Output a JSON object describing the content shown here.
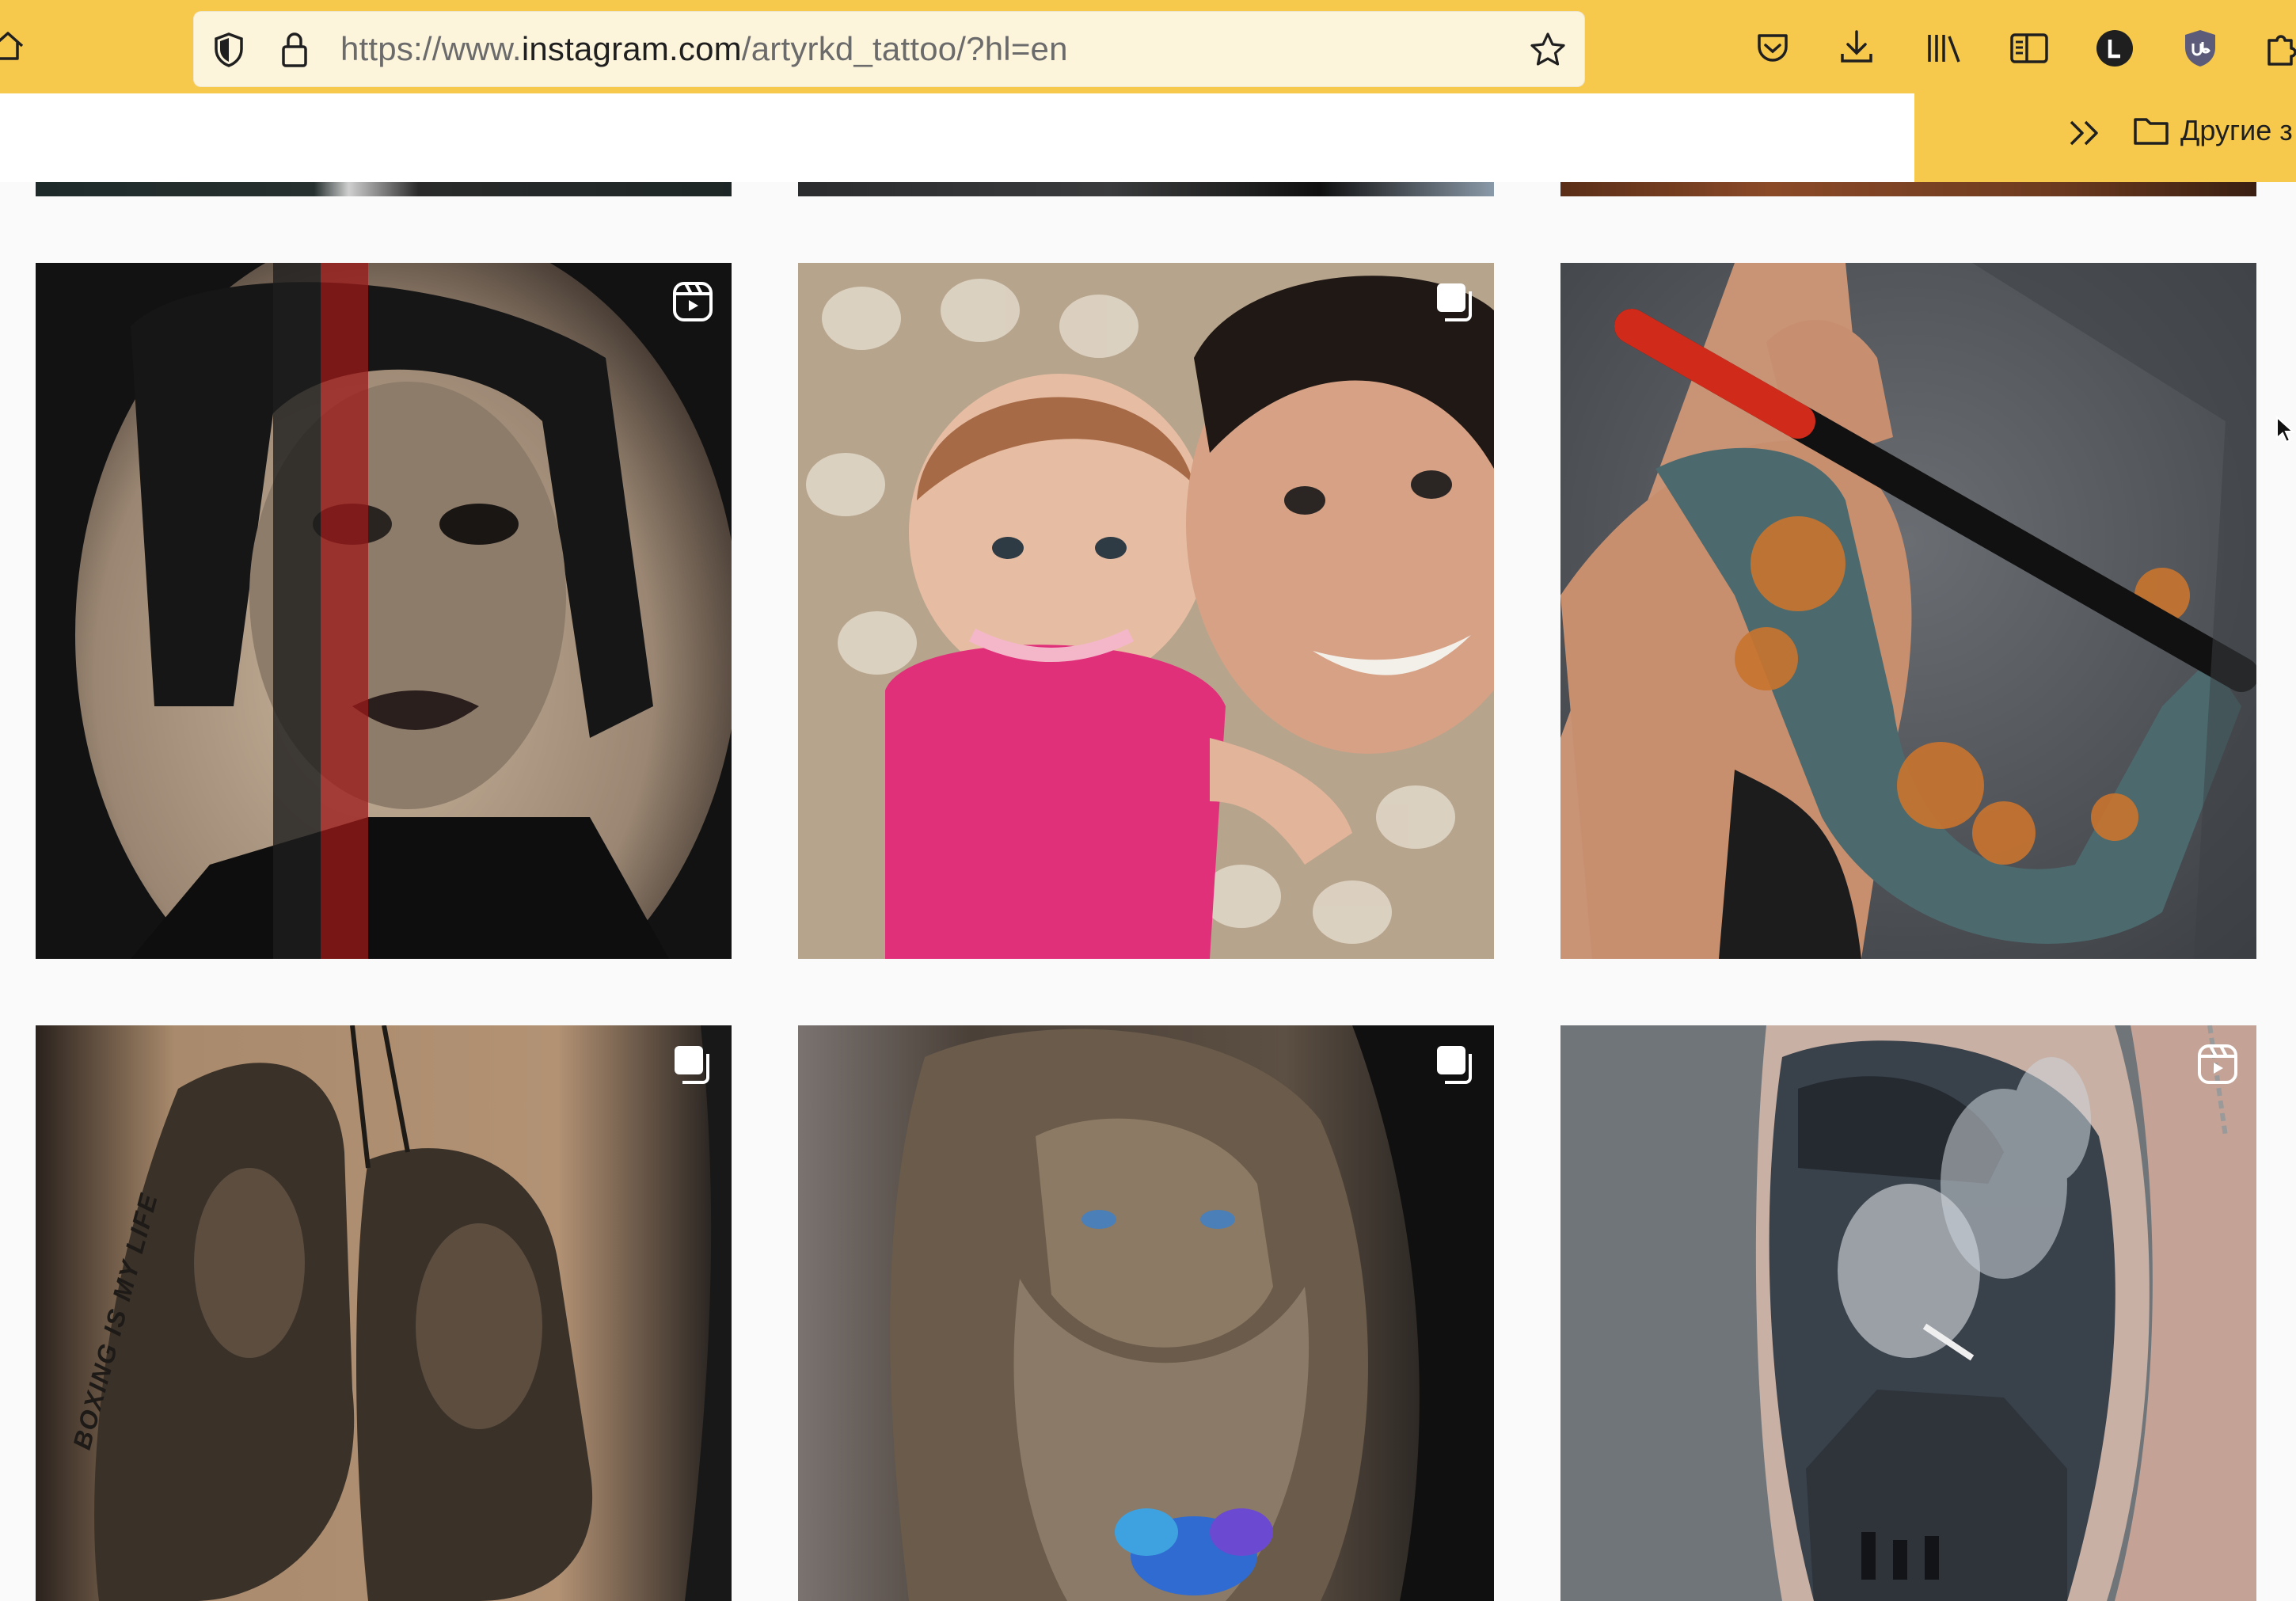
{
  "browser": {
    "url_prefix": "https://www.",
    "url_domain": "instagram.com",
    "url_suffix": "/artyrkd_tattoo/?hl=en",
    "bookmarks_folder_label": "Другие з",
    "toolbar_color": "#f6c94c",
    "icons": [
      "home-icon",
      "shield-icon",
      "lock-icon",
      "star-icon",
      "pocket-icon",
      "download-icon",
      "library-icon",
      "sidebar-icon",
      "account-icon",
      "ublock-icon",
      "extensions-icon",
      "overflow-chevrons-icon",
      "folder-icon"
    ]
  },
  "profile_grid": {
    "posts": [
      {
        "name": "post-portrait-red-stripe",
        "badge": "reel-icon",
        "tones": [
          "#2a2a2a",
          "#b9a48f",
          "#9c1a1a"
        ]
      },
      {
        "name": "post-baby-selfie",
        "badge": "carousel-icon",
        "tones": [
          "#b9a58f",
          "#e0307a",
          "#d6a58a"
        ]
      },
      {
        "name": "post-baseball-bat-sleeve",
        "badge": null,
        "tones": [
          "#55595e",
          "#c98d6f",
          "#c9742e"
        ]
      },
      {
        "name": "post-boxing-gloves",
        "badge": "carousel-icon",
        "tones": [
          "#3a2f28",
          "#8a7358",
          "#b08a6a"
        ]
      },
      {
        "name": "post-old-man-beard",
        "badge": "carousel-icon",
        "tones": [
          "#3b342d",
          "#8c7a64",
          "#2f6bd1"
        ]
      },
      {
        "name": "post-smoking-man-sleeve",
        "badge": "reel-icon",
        "tones": [
          "#6c7176",
          "#c7a89a",
          "#2c3138"
        ]
      }
    ],
    "visible_texts": {
      "boxing_text": "BOXING IS MY LIFE"
    }
  }
}
